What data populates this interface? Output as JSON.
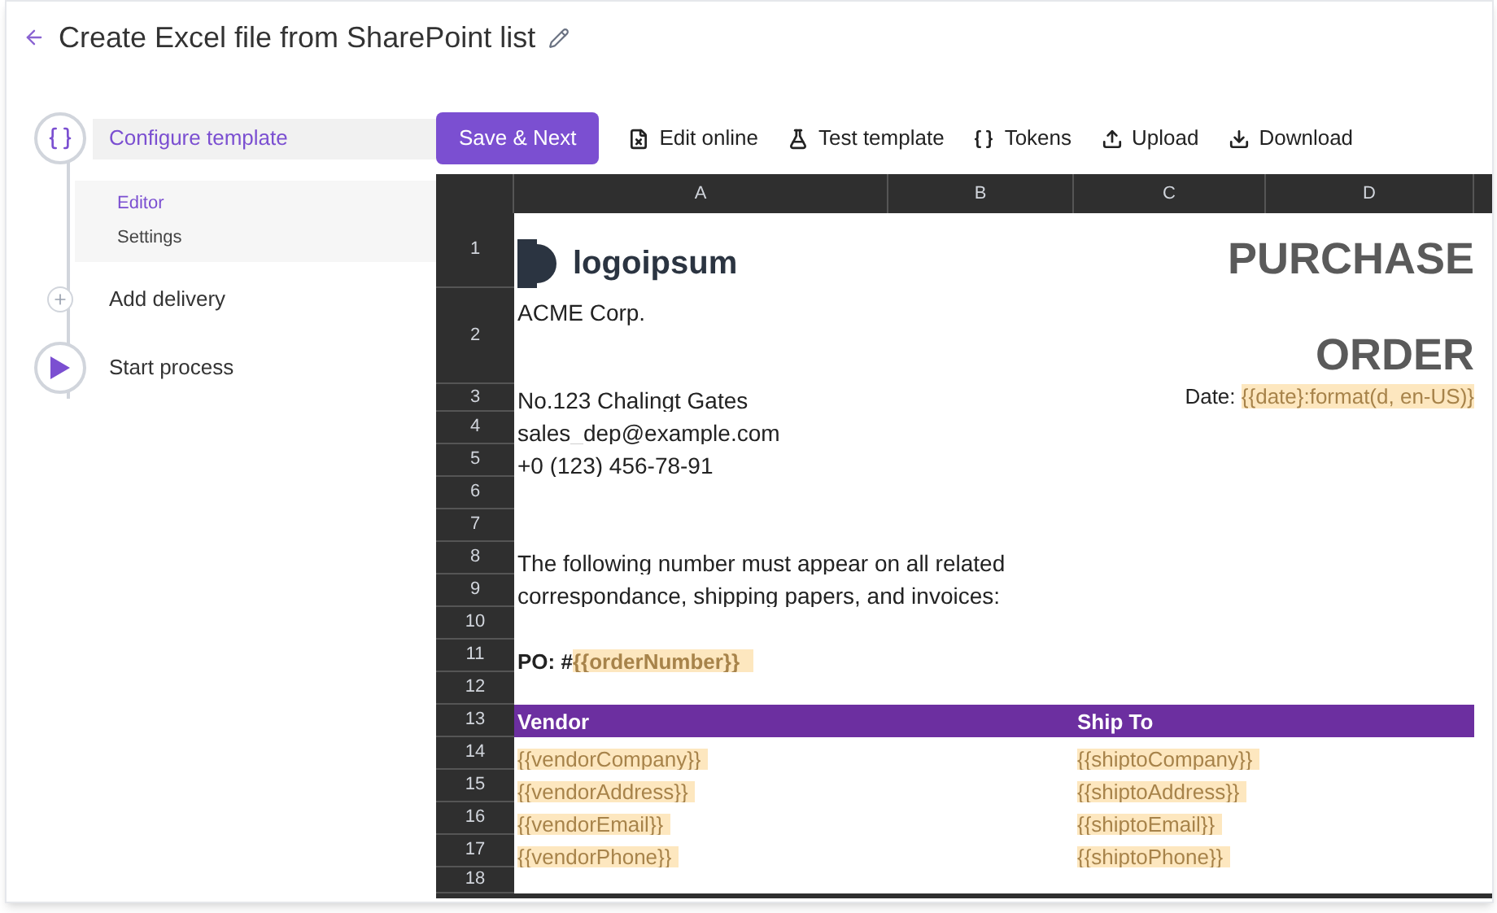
{
  "title": "Create Excel file from SharePoint list",
  "steps": [
    {
      "kind": "template",
      "label": "Configure template",
      "selected": true,
      "children": [
        {
          "label": "Editor",
          "selected": true
        },
        {
          "label": "Settings",
          "selected": false
        }
      ]
    },
    {
      "kind": "add",
      "label": "Add delivery",
      "selected": false
    },
    {
      "kind": "start",
      "label": "Start process",
      "selected": false
    }
  ],
  "toolbar": [
    {
      "kind": "primary",
      "label": "Save & Next"
    },
    {
      "kind": "file",
      "label": "Edit online"
    },
    {
      "kind": "flask",
      "label": "Test template"
    },
    {
      "kind": "braces",
      "label": "Tokens"
    },
    {
      "kind": "upload",
      "label": "Upload"
    },
    {
      "kind": "download",
      "label": "Download"
    }
  ],
  "sheet": {
    "columns": [
      "A",
      "B",
      "C",
      "D"
    ],
    "rows": [
      {
        "number": "1",
        "left": {
          "kind": "logo",
          "text": "logoipsum"
        },
        "right": {
          "kind": "heading",
          "text": "PURCHASE"
        }
      },
      {
        "number": "2",
        "left": {
          "kind": "text",
          "text": "ACME Corp."
        },
        "right": {
          "kind": "heading",
          "text": "ORDER"
        }
      },
      {
        "number": "3",
        "left": {
          "kind": "text",
          "text": "No.123 Chalingt Gates"
        },
        "right": {
          "kind": "field",
          "label": "Date:",
          "token": "{{date}:format(d, en-US)}"
        }
      },
      {
        "number": "4",
        "left": {
          "kind": "text",
          "text": "sales_dep@example.com"
        }
      },
      {
        "number": "5",
        "left": {
          "kind": "text",
          "text": "+0 (123) 456-78-91"
        }
      },
      {
        "number": "6"
      },
      {
        "number": "7"
      },
      {
        "number": "8",
        "left": {
          "kind": "text",
          "text": "The following number must appear on all related"
        }
      },
      {
        "number": "9",
        "left": {
          "kind": "text",
          "text": "correspondance, shipping papers, and invoices:"
        }
      },
      {
        "number": "10"
      },
      {
        "number": "11",
        "left": {
          "kind": "boldfield",
          "label": "PO: #",
          "token": "{{orderNumber}}"
        }
      },
      {
        "number": "12"
      },
      {
        "number": "13",
        "kind": "header",
        "left": {
          "kind": "header",
          "text": "Vendor"
        },
        "right": {
          "kind": "header",
          "text": "Ship To"
        }
      },
      {
        "number": "14",
        "left": {
          "kind": "token",
          "text": "{{vendorCompany}}"
        },
        "right": {
          "kind": "token",
          "text": "{{shiptoCompany}}"
        }
      },
      {
        "number": "15",
        "left": {
          "kind": "token",
          "text": "{{vendorAddress}}"
        },
        "right": {
          "kind": "token",
          "text": "{{shiptoAddress}}"
        }
      },
      {
        "number": "16",
        "left": {
          "kind": "token",
          "text": "{{vendorEmail}}"
        },
        "right": {
          "kind": "token",
          "text": "{{shiptoEmail}}"
        }
      },
      {
        "number": "17",
        "left": {
          "kind": "token",
          "text": "{{vendorPhone}}"
        },
        "right": {
          "kind": "token",
          "text": "{{shiptoPhone}}"
        }
      },
      {
        "number": "18"
      }
    ]
  }
}
